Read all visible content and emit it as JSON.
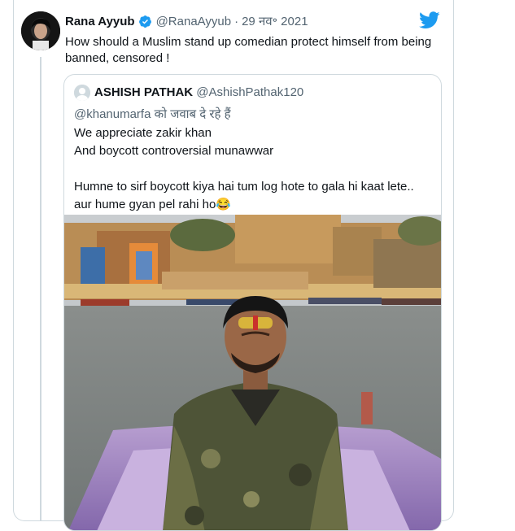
{
  "tweet": {
    "author_name": "Rana Ayyub",
    "author_handle": "@RanaAyyub",
    "separator": "·",
    "date": "29 नव॰ 2021",
    "text": "How should a Muslim stand up comedian protect himself from being banned, censored !"
  },
  "quoted": {
    "author_name": "ASHISH PATHAK",
    "author_handle": "@AshishPathak120",
    "reply_mention": "@khanumarfa",
    "reply_suffix": " को जवाब दे रहे हैं",
    "text": "We appreciate zakir khan\n And boycott controversial munawwar\n\nHumne to sirf boycott kiya hai tum log hote to gala hi kaat lete.. aur hume gyan pel rahi ho😂"
  },
  "colors": {
    "twitter_blue": "#1d9bf0",
    "text_primary": "#0f1419",
    "text_secondary": "#536471",
    "border": "#cfd9de"
  },
  "icons": {
    "verified": "verified-badge-icon",
    "logo": "twitter-bird-icon"
  }
}
